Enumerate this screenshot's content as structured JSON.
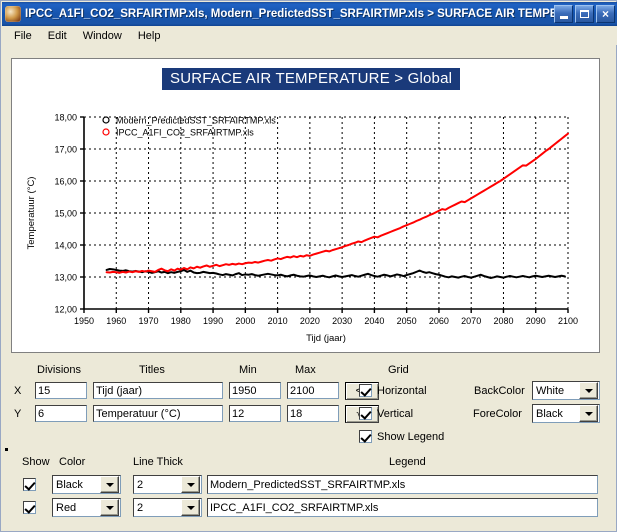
{
  "window": {
    "title": "IPCC_A1FI_CO2_SRFAIRTMP.xls, Modern_PredictedSST_SRFAIRTMP.xls > SURFACE AIR TEMPE...",
    "minimize_label": "Minimize",
    "maximize_label": "Maximize",
    "close_label": "×"
  },
  "menu": {
    "items": [
      {
        "label": "File"
      },
      {
        "label": "Edit"
      },
      {
        "label": "Window"
      },
      {
        "label": "Help"
      }
    ]
  },
  "chart_data": {
    "type": "line",
    "title": "SURFACE AIR TEMPERATURE > Global",
    "xlabel": "Tijd (jaar)",
    "ylabel": "Temperatuur (°C)",
    "xlim": [
      1950,
      2100
    ],
    "ylim": [
      12,
      18
    ],
    "xticks": [
      1950,
      1960,
      1970,
      1980,
      1990,
      2000,
      2010,
      2020,
      2030,
      2040,
      2050,
      2060,
      2070,
      2080,
      2090,
      2100
    ],
    "xticklabels": [
      "1950",
      "1960",
      "1970",
      "1980",
      "1990",
      "2000",
      "2010",
      "2020",
      "2030",
      "2040",
      "2050",
      "2060",
      "2070",
      "2080",
      "2090",
      "2100"
    ],
    "yticks": [
      12,
      13,
      14,
      15,
      16,
      17,
      18
    ],
    "yticklabels": [
      "12,00",
      "13,00",
      "14,00",
      "15,00",
      "16,00",
      "17,00",
      "18,00"
    ],
    "grid": {
      "horizontal": true,
      "vertical": true,
      "style": "dashed"
    },
    "legend": {
      "position": "top-left",
      "visible": true,
      "marker": "open-circle"
    },
    "series": [
      {
        "name": "Modern_PredictedSST_SRFAIRTMP.xls",
        "color": "#000000",
        "line_thick": 2,
        "x": [
          1957,
          1958,
          1959,
          1960,
          1961,
          1962,
          1963,
          1964,
          1965,
          1966,
          1967,
          1968,
          1969,
          1970,
          1971,
          1972,
          1973,
          1974,
          1975,
          1976,
          1977,
          1978,
          1979,
          1980,
          1981,
          1982,
          1983,
          1984,
          1985,
          1986,
          1987,
          1988,
          1989,
          1990,
          1991,
          1992,
          1993,
          1994,
          1995,
          1996,
          1997,
          1998,
          1999,
          2000,
          2001,
          2002,
          2003,
          2004,
          2005,
          2006,
          2007,
          2008,
          2009,
          2010,
          2011,
          2012,
          2013,
          2014,
          2015,
          2016,
          2017,
          2018,
          2019,
          2020,
          2021,
          2022,
          2023,
          2024,
          2025,
          2026,
          2027,
          2028,
          2029,
          2030,
          2031,
          2032,
          2033,
          2034,
          2035,
          2036,
          2037,
          2038,
          2039,
          2040,
          2041,
          2042,
          2043,
          2044,
          2045,
          2046,
          2047,
          2048,
          2049,
          2050,
          2051,
          2052,
          2053,
          2054,
          2055,
          2056,
          2057,
          2058,
          2059,
          2060,
          2061,
          2062,
          2063,
          2064,
          2065,
          2066,
          2067,
          2068,
          2069,
          2070,
          2071,
          2072,
          2073,
          2074,
          2075,
          2076,
          2077,
          2078,
          2079,
          2080,
          2081,
          2082,
          2083,
          2084,
          2085,
          2086,
          2087,
          2088,
          2089,
          2090,
          2091,
          2092,
          2093,
          2094,
          2095,
          2096,
          2097,
          2098,
          2099,
          2100
        ],
        "y": [
          13.22,
          13.25,
          13.24,
          13.22,
          13.2,
          13.19,
          13.21,
          13.18,
          13.17,
          13.19,
          13.17,
          13.15,
          13.18,
          13.16,
          13.13,
          13.15,
          13.18,
          13.14,
          13.16,
          13.12,
          13.15,
          13.13,
          13.16,
          13.18,
          13.22,
          13.16,
          13.2,
          13.14,
          13.12,
          13.13,
          13.16,
          13.14,
          13.12,
          13.13,
          13.11,
          13.08,
          13.06,
          13.09,
          13.07,
          13.05,
          13.09,
          13.12,
          13.06,
          13.08,
          13.07,
          13.09,
          13.06,
          13.04,
          13.06,
          13.08,
          13.1,
          13.08,
          13.06,
          13.05,
          13.07,
          13.04,
          13.02,
          13.05,
          13.07,
          13.04,
          13.02,
          13.01,
          13.03,
          13.05,
          13.02,
          13.0,
          13.02,
          13.04,
          13.01,
          12.99,
          13.02,
          13.05,
          13.02,
          13.0,
          13.02,
          13.04,
          13.06,
          13.03,
          13.01,
          13.04,
          13.07,
          13.1,
          13.06,
          13.03,
          13.01,
          13.04,
          13.07,
          13.05,
          13.02,
          13.05,
          13.08,
          13.06,
          13.03,
          13.06,
          13.09,
          13.12,
          13.16,
          13.2,
          13.16,
          13.13,
          13.15,
          13.12,
          13.09,
          13.07,
          13.04,
          13.01,
          12.99,
          13.02,
          13.0,
          12.98,
          13.01,
          13.03,
          13.0,
          12.98,
          13.01,
          13.04,
          13.07,
          13.03,
          13.0,
          12.97,
          12.99,
          13.02,
          13.0,
          12.98,
          13.01,
          13.03,
          13.01,
          12.99,
          13.01,
          13.03,
          13.01,
          12.99,
          13.02,
          13.04,
          13.02,
          13.0,
          13.02,
          13.04,
          13.02,
          13.0,
          13.02,
          13.04,
          13.02
        ]
      },
      {
        "name": "IPCC_A1FI_CO2_SRFAIRTMP.xls",
        "color": "#ff0000",
        "line_thick": 2,
        "x": [
          1957,
          1958,
          1959,
          1960,
          1961,
          1962,
          1963,
          1964,
          1965,
          1966,
          1967,
          1968,
          1969,
          1970,
          1971,
          1972,
          1973,
          1974,
          1975,
          1976,
          1977,
          1978,
          1979,
          1980,
          1981,
          1982,
          1983,
          1984,
          1985,
          1986,
          1987,
          1988,
          1989,
          1990,
          1991,
          1992,
          1993,
          1994,
          1995,
          1996,
          1997,
          1998,
          1999,
          2000,
          2001,
          2002,
          2003,
          2004,
          2005,
          2006,
          2007,
          2008,
          2009,
          2010,
          2011,
          2012,
          2013,
          2014,
          2015,
          2016,
          2017,
          2018,
          2019,
          2020,
          2021,
          2022,
          2023,
          2024,
          2025,
          2026,
          2027,
          2028,
          2029,
          2030,
          2031,
          2032,
          2033,
          2034,
          2035,
          2036,
          2037,
          2038,
          2039,
          2040,
          2041,
          2042,
          2043,
          2044,
          2045,
          2046,
          2047,
          2048,
          2049,
          2050,
          2051,
          2052,
          2053,
          2054,
          2055,
          2056,
          2057,
          2058,
          2059,
          2060,
          2061,
          2062,
          2063,
          2064,
          2065,
          2066,
          2067,
          2068,
          2069,
          2070,
          2071,
          2072,
          2073,
          2074,
          2075,
          2076,
          2077,
          2078,
          2079,
          2080,
          2081,
          2082,
          2083,
          2084,
          2085,
          2086,
          2087,
          2088,
          2089,
          2090,
          2091,
          2092,
          2093,
          2094,
          2095,
          2096,
          2097,
          2098,
          2099,
          2100
        ],
        "y": [
          13.15,
          13.14,
          13.16,
          13.15,
          13.13,
          13.16,
          13.14,
          13.17,
          13.15,
          13.18,
          13.16,
          13.19,
          13.17,
          13.2,
          13.18,
          13.16,
          13.22,
          13.26,
          13.21,
          13.18,
          13.24,
          13.2,
          13.26,
          13.23,
          13.28,
          13.24,
          13.3,
          13.27,
          13.32,
          13.29,
          13.33,
          13.36,
          13.32,
          13.35,
          13.38,
          13.34,
          13.37,
          13.4,
          13.38,
          13.41,
          13.39,
          13.42,
          13.4,
          13.43,
          13.45,
          13.44,
          13.47,
          13.45,
          13.48,
          13.51,
          13.53,
          13.51,
          13.55,
          13.58,
          13.56,
          13.6,
          13.63,
          13.61,
          13.65,
          13.62,
          13.66,
          13.64,
          13.68,
          13.66,
          13.7,
          13.73,
          13.76,
          13.79,
          13.82,
          13.8,
          13.84,
          13.87,
          13.9,
          13.93,
          13.97,
          14.0,
          14.04,
          14.07,
          14.11,
          14.09,
          14.14,
          14.18,
          14.22,
          14.26,
          14.24,
          14.29,
          14.33,
          14.37,
          14.41,
          14.45,
          14.49,
          14.53,
          14.58,
          14.62,
          14.66,
          14.7,
          14.75,
          14.79,
          14.84,
          14.88,
          14.93,
          14.97,
          15.02,
          15.07,
          15.12,
          15.1,
          15.16,
          15.21,
          15.26,
          15.31,
          15.36,
          15.34,
          15.4,
          15.46,
          15.52,
          15.58,
          15.64,
          15.7,
          15.76,
          15.82,
          15.88,
          15.94,
          16.0,
          16.07,
          16.14,
          16.21,
          16.28,
          16.35,
          16.42,
          16.49,
          16.48,
          16.55,
          16.62,
          16.69,
          16.77,
          16.85,
          16.93,
          17.0,
          17.08,
          17.16,
          17.24,
          17.32,
          17.4,
          17.48
        ]
      }
    ]
  },
  "settings": {
    "headers": {
      "divisions": "Divisions",
      "titles": "Titles",
      "min": "Min",
      "max": "Max",
      "grid": "Grid"
    },
    "rows": [
      {
        "axis": "X",
        "divisions": "15",
        "title": "Tijd (jaar)",
        "min": "1950",
        "max": "2100",
        "button": "<>"
      },
      {
        "axis": "Y",
        "divisions": "6",
        "title": "Temperatuur (°C)",
        "min": "12",
        "max": "18",
        "button": "√^"
      }
    ],
    "grid_options": [
      {
        "label": "Horizontal",
        "checked": true
      },
      {
        "label": "Vertical",
        "checked": true
      },
      {
        "label": "Show Legend",
        "checked": true
      }
    ],
    "colors": [
      {
        "label": "BackColor",
        "value": "White"
      },
      {
        "label": "ForeColor",
        "value": "Black"
      }
    ]
  },
  "series_panel": {
    "headers": {
      "show": "Show",
      "color": "Color",
      "line_thick": "Line Thick",
      "legend": "Legend"
    },
    "rows": [
      {
        "show": true,
        "color": "Black",
        "line_thick": "2",
        "legend": "Modern_PredictedSST_SRFAIRTMP.xls"
      },
      {
        "show": true,
        "color": "Red",
        "line_thick": "2",
        "legend": "IPCC_A1FI_CO2_SRFAIRTMP.xls"
      }
    ]
  }
}
